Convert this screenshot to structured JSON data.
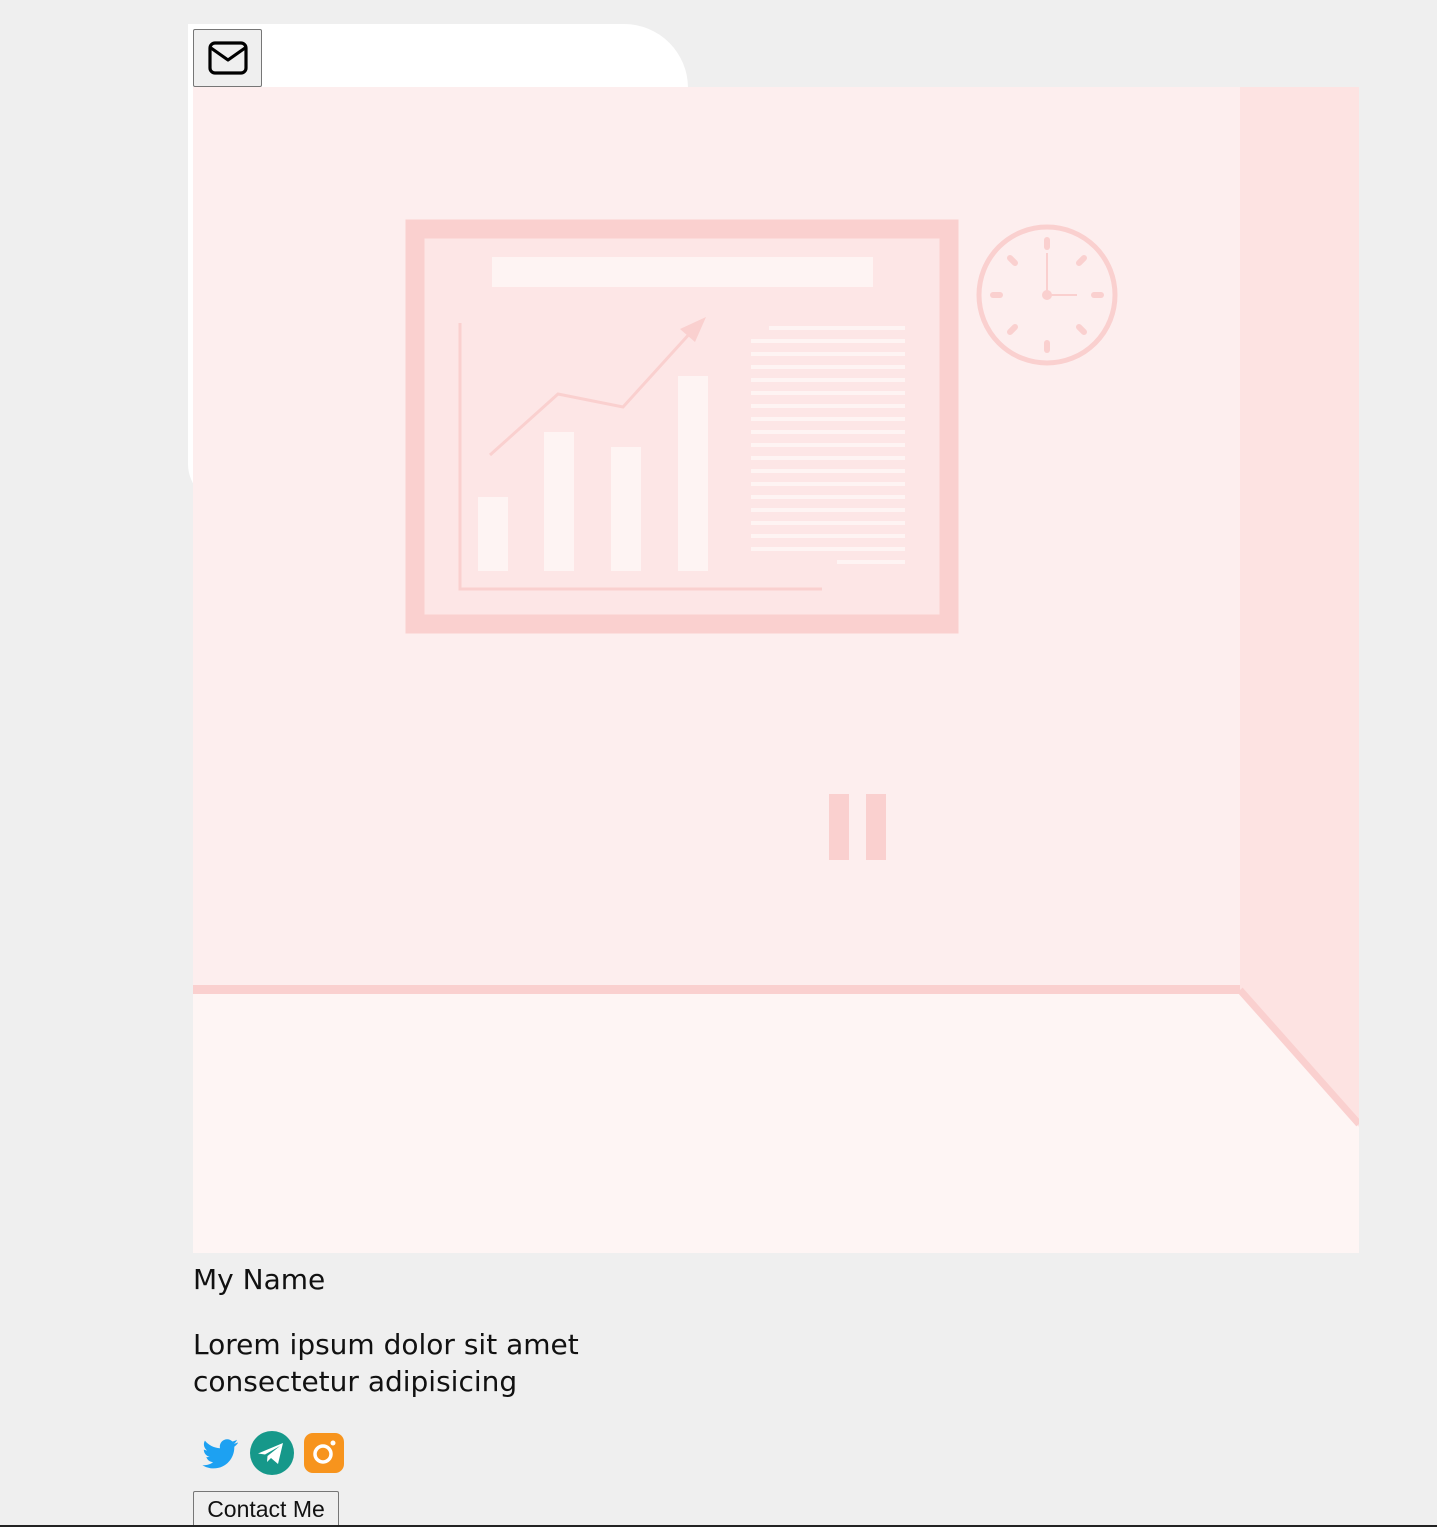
{
  "profile": {
    "name": "My Name",
    "description": "Lorem ipsum dolor sit amet consectetur adipisicing",
    "contact_label": "Contact Me"
  },
  "icons": {
    "mail": "envelope-icon",
    "socials": [
      "twitter-icon",
      "telegram-icon",
      "instagram-icon"
    ]
  },
  "colors": {
    "page_background": "#efefef",
    "wall": "#fdeeee",
    "side_wall": "#fde3e2",
    "floor": "#fef5f4",
    "accent_pink": "#fad0cf",
    "twitter": "#1da1f2",
    "telegram": "#16988a",
    "instagram": "#f7941d"
  }
}
